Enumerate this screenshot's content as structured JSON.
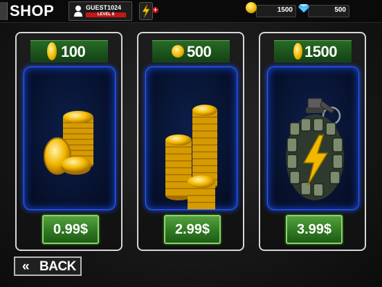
{
  "header": {
    "title": "SHOP",
    "profile": {
      "username": "GUEST1024",
      "level_label": "LEVEL 8"
    },
    "currencies": {
      "coins": {
        "icon": "coin-icon",
        "value": "1500"
      },
      "gems": {
        "icon": "gem-icon",
        "value": "500"
      }
    },
    "energy": {
      "icon": "lightning-icon",
      "plus": "+"
    }
  },
  "offers": [
    {
      "amount": "100",
      "price": "0.99$",
      "image": "coins-small-pile"
    },
    {
      "amount": "500",
      "price": "2.99$",
      "image": "coins-large-stacks"
    },
    {
      "amount": "1500",
      "price": "3.99$",
      "image": "energy-grenade"
    }
  ],
  "back_button": {
    "chevron": "«",
    "label": "BACK"
  },
  "colors": {
    "panel_glow": "#1a50ff",
    "price_green": "#2f7a22",
    "level_red": "#c41818",
    "coin_gold": "#f0b800"
  }
}
